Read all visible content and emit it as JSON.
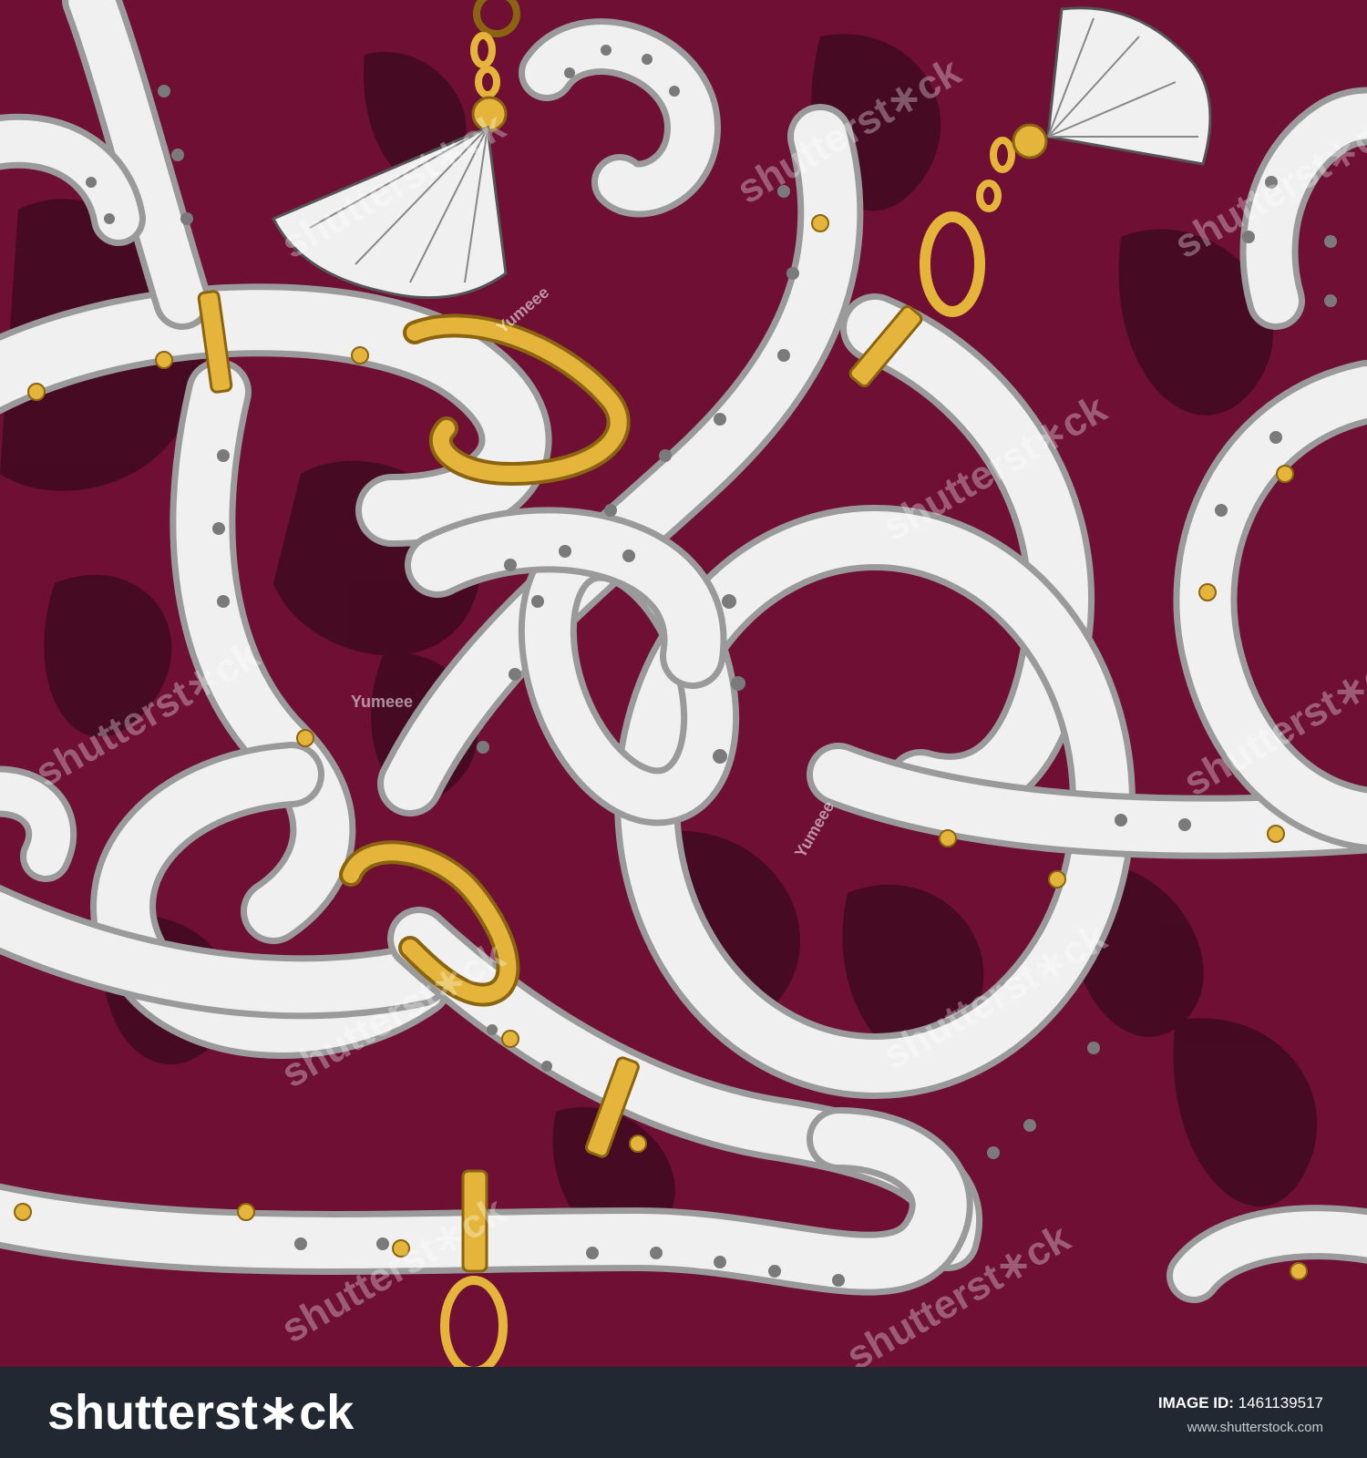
{
  "colors": {
    "background": "#6e0f33",
    "shadow": "#3f0920",
    "belt_fill": "#f0f0f0",
    "belt_edge": "#9a9a9a",
    "gold": "#e4b53a",
    "gold_dark": "#8a6410",
    "footer": "#222831"
  },
  "watermark": {
    "text": "shutterst∗ck",
    "author": "Yumeee"
  },
  "footer": {
    "logo": "shutterst∗ck",
    "image_id_label": "IMAGE ID:",
    "image_id_value": "1461139517",
    "site_url": "www.shutterstock.com"
  }
}
